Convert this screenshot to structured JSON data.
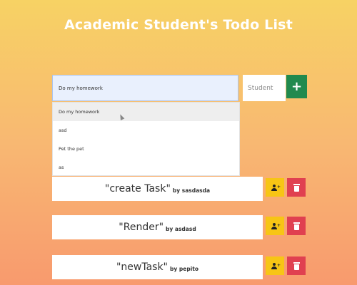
{
  "app": {
    "title": "Academic Student's Todo List"
  },
  "form": {
    "task_value": "Do my homework",
    "student_placeholder": "Student",
    "add_label": "+"
  },
  "suggestions": [
    {
      "label": "Do my homework"
    },
    {
      "label": "asd"
    },
    {
      "label": "Pet the pet"
    },
    {
      "label": "as"
    }
  ],
  "tasks": [
    {
      "name": "\"create Task\"",
      "by": "by sasdasda"
    },
    {
      "name": "\"Render\"",
      "by": "by asdasd"
    },
    {
      "name": "\"newTask\"",
      "by": "by pepito"
    }
  ],
  "colors": {
    "add_button": "#218a4e",
    "assign_button": "#f7c515",
    "delete_button": "#e04050",
    "background_top": "#f7d264",
    "background_bottom": "#f89a6e"
  },
  "icons": {
    "add": "plus-icon",
    "assign": "user-plus-icon",
    "delete": "trash-icon"
  }
}
